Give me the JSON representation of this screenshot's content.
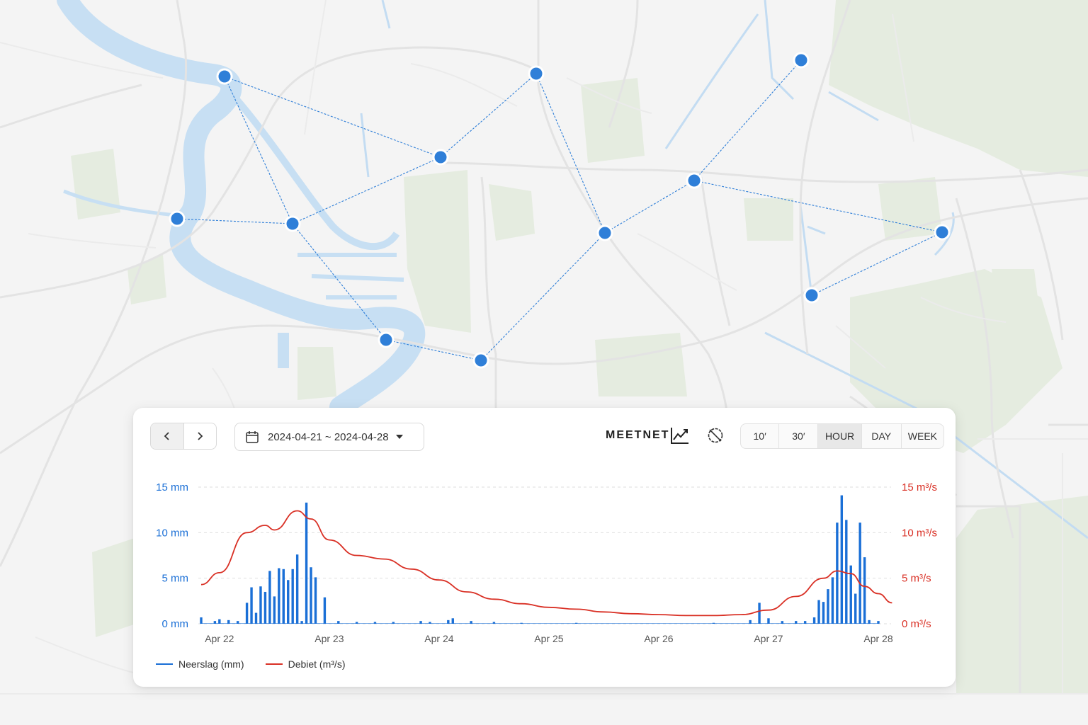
{
  "toolbar": {
    "date_range": "2024-04-21 ~ 2024-04-28",
    "brand": "MEETNET",
    "resolutions": [
      {
        "label": "10′",
        "active": false
      },
      {
        "label": "30′",
        "active": false
      },
      {
        "label": "HOUR",
        "active": true
      },
      {
        "label": "DAY",
        "active": false
      },
      {
        "label": "WEEK",
        "active": false
      }
    ]
  },
  "icons": {
    "prev": "chevron-left-icon",
    "next": "chevron-right-icon",
    "calendar": "calendar-icon",
    "dropdown": "caret-down-icon",
    "brand": "trend-chart-icon",
    "nodata": "no-data-icon"
  },
  "colors": {
    "precipitation": "#1a6fd6",
    "discharge": "#d93025",
    "station": "#2f7fd8",
    "river": "#c7dff3",
    "park": "#e6ede1"
  },
  "legend": {
    "precipitation": "Neerslag (mm)",
    "discharge": "Debiet (m³/s)"
  },
  "chart_data": {
    "type": "bar",
    "x_axis": {
      "type": "time",
      "range": [
        "2024-04-21T20:00",
        "2024-04-28T00:00"
      ],
      "tick_labels": [
        "Apr 22",
        "Apr 23",
        "Apr 24",
        "Apr 25",
        "Apr 26",
        "Apr 27",
        "Apr 28"
      ]
    },
    "y_left": {
      "label": "",
      "unit": "mm",
      "range": [
        0,
        15
      ],
      "tick_labels": [
        "0 mm",
        "5 mm",
        "10 mm",
        "15 mm"
      ]
    },
    "y_right": {
      "label": "",
      "unit": "m³/s",
      "range": [
        0,
        15
      ],
      "tick_labels": [
        "0 m³/s",
        "5 m³/s",
        "10 m³/s",
        "15 m³/s"
      ]
    },
    "grid": "horizontal dashed",
    "legend_position": "bottom-left",
    "series": [
      {
        "name": "Neerslag (mm)",
        "type": "bar",
        "axis": "left",
        "points": [
          [
            "2024-04-21T20:00",
            0.7
          ],
          [
            "2024-04-21T23:00",
            0.3
          ],
          [
            "2024-04-22T00:00",
            0.5
          ],
          [
            "2024-04-22T02:00",
            0.4
          ],
          [
            "2024-04-22T04:00",
            0.3
          ],
          [
            "2024-04-22T06:00",
            2.3
          ],
          [
            "2024-04-22T07:00",
            4.0
          ],
          [
            "2024-04-22T08:00",
            1.2
          ],
          [
            "2024-04-22T09:00",
            4.1
          ],
          [
            "2024-04-22T10:00",
            3.5
          ],
          [
            "2024-04-22T11:00",
            5.8
          ],
          [
            "2024-04-22T12:00",
            3.0
          ],
          [
            "2024-04-22T13:00",
            6.1
          ],
          [
            "2024-04-22T14:00",
            6.0
          ],
          [
            "2024-04-22T15:00",
            4.8
          ],
          [
            "2024-04-22T16:00",
            6.0
          ],
          [
            "2024-04-22T17:00",
            7.6
          ],
          [
            "2024-04-22T18:00",
            0.3
          ],
          [
            "2024-04-22T19:00",
            13.3
          ],
          [
            "2024-04-22T20:00",
            6.2
          ],
          [
            "2024-04-22T21:00",
            5.1
          ],
          [
            "2024-04-22T23:00",
            2.9
          ],
          [
            "2024-04-23T02:00",
            0.3
          ],
          [
            "2024-04-23T06:00",
            0.2
          ],
          [
            "2024-04-23T10:00",
            0.2
          ],
          [
            "2024-04-23T14:00",
            0.2
          ],
          [
            "2024-04-23T20:00",
            0.3
          ],
          [
            "2024-04-23T22:00",
            0.2
          ],
          [
            "2024-04-24T02:00",
            0.4
          ],
          [
            "2024-04-24T03:00",
            0.6
          ],
          [
            "2024-04-24T07:00",
            0.3
          ],
          [
            "2024-04-24T12:00",
            0.2
          ],
          [
            "2024-04-24T18:00",
            0.1
          ],
          [
            "2024-04-25T06:00",
            0.1
          ],
          [
            "2024-04-26T12:00",
            0.1
          ],
          [
            "2024-04-26T20:00",
            0.4
          ],
          [
            "2024-04-26T22:00",
            2.3
          ],
          [
            "2024-04-27T00:00",
            0.6
          ],
          [
            "2024-04-27T03:00",
            0.3
          ],
          [
            "2024-04-27T06:00",
            0.3
          ],
          [
            "2024-04-27T08:00",
            0.3
          ],
          [
            "2024-04-27T10:00",
            0.7
          ],
          [
            "2024-04-27T11:00",
            2.6
          ],
          [
            "2024-04-27T12:00",
            2.4
          ],
          [
            "2024-04-27T13:00",
            3.8
          ],
          [
            "2024-04-27T14:00",
            5.1
          ],
          [
            "2024-04-27T15:00",
            11.1
          ],
          [
            "2024-04-27T16:00",
            14.1
          ],
          [
            "2024-04-27T17:00",
            11.4
          ],
          [
            "2024-04-27T18:00",
            6.4
          ],
          [
            "2024-04-27T19:00",
            3.3
          ],
          [
            "2024-04-27T20:00",
            11.1
          ],
          [
            "2024-04-27T21:00",
            7.3
          ],
          [
            "2024-04-27T22:00",
            0.4
          ],
          [
            "2024-04-28T00:00",
            0.3
          ]
        ]
      },
      {
        "name": "Debiet (m³/s)",
        "type": "line",
        "axis": "right",
        "points": [
          [
            "2024-04-21T20:00",
            4.3
          ],
          [
            "2024-04-22T00:00",
            5.6
          ],
          [
            "2024-04-22T06:00",
            10.0
          ],
          [
            "2024-04-22T10:00",
            10.8
          ],
          [
            "2024-04-22T12:00",
            10.3
          ],
          [
            "2024-04-22T17:00",
            12.4
          ],
          [
            "2024-04-22T20:00",
            11.5
          ],
          [
            "2024-04-23T00:00",
            9.2
          ],
          [
            "2024-04-23T06:00",
            7.5
          ],
          [
            "2024-04-23T12:00",
            7.1
          ],
          [
            "2024-04-23T18:00",
            6.0
          ],
          [
            "2024-04-24T00:00",
            4.8
          ],
          [
            "2024-04-24T06:00",
            3.5
          ],
          [
            "2024-04-24T12:00",
            2.7
          ],
          [
            "2024-04-24T18:00",
            2.2
          ],
          [
            "2024-04-25T00:00",
            1.8
          ],
          [
            "2024-04-25T06:00",
            1.6
          ],
          [
            "2024-04-25T12:00",
            1.3
          ],
          [
            "2024-04-25T18:00",
            1.1
          ],
          [
            "2024-04-26T00:00",
            1.0
          ],
          [
            "2024-04-26T06:00",
            0.9
          ],
          [
            "2024-04-26T12:00",
            0.9
          ],
          [
            "2024-04-26T18:00",
            1.0
          ],
          [
            "2024-04-27T00:00",
            1.5
          ],
          [
            "2024-04-27T06:00",
            3.0
          ],
          [
            "2024-04-27T12:00",
            5.0
          ],
          [
            "2024-04-27T15:00",
            5.8
          ],
          [
            "2024-04-27T18:00",
            5.5
          ],
          [
            "2024-04-27T21:00",
            4.1
          ],
          [
            "2024-04-28T00:00",
            3.3
          ],
          [
            "2024-04-28T03:00",
            2.3
          ]
        ]
      }
    ]
  }
}
